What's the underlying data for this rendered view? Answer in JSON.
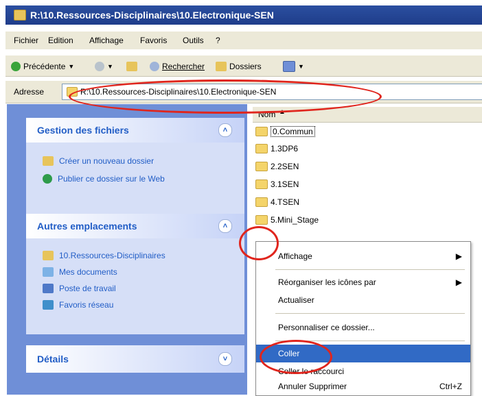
{
  "window": {
    "title": "R:\\10.Ressources-Disciplinaires\\10.Electronique-SEN"
  },
  "menubar": [
    "Fichier",
    "Edition",
    "Affichage",
    "Favoris",
    "Outils",
    "?"
  ],
  "toolbar": {
    "back": "Précédente",
    "search": "Rechercher",
    "folders": "Dossiers"
  },
  "address": {
    "label": "Adresse",
    "path": "R:\\10.Ressources-Disciplinaires\\10.Electronique-SEN"
  },
  "tasks": {
    "file_tasks": {
      "title": "Gestion des fichiers",
      "items": [
        "Créer un nouveau dossier",
        "Publier ce dossier sur le Web"
      ]
    },
    "other_places": {
      "title": "Autres emplacements",
      "items": [
        "10.Ressources-Disciplinaires",
        "Mes documents",
        "Poste de travail",
        "Favoris réseau"
      ]
    },
    "details": {
      "title": "Détails"
    }
  },
  "list": {
    "column": "Nom",
    "folders": [
      "0.Commun",
      "1.3DP6",
      "2.2SEN",
      "3.1SEN",
      "4.TSEN",
      "5.Mini_Stage"
    ]
  },
  "context_menu": {
    "items": [
      "Affichage",
      "Réorganiser les icônes par",
      "Actualiser",
      "Personnaliser ce dossier...",
      "Coller",
      "Coller le raccourci",
      "Annuler Supprimer"
    ],
    "undo_shortcut": "Ctrl+Z"
  }
}
